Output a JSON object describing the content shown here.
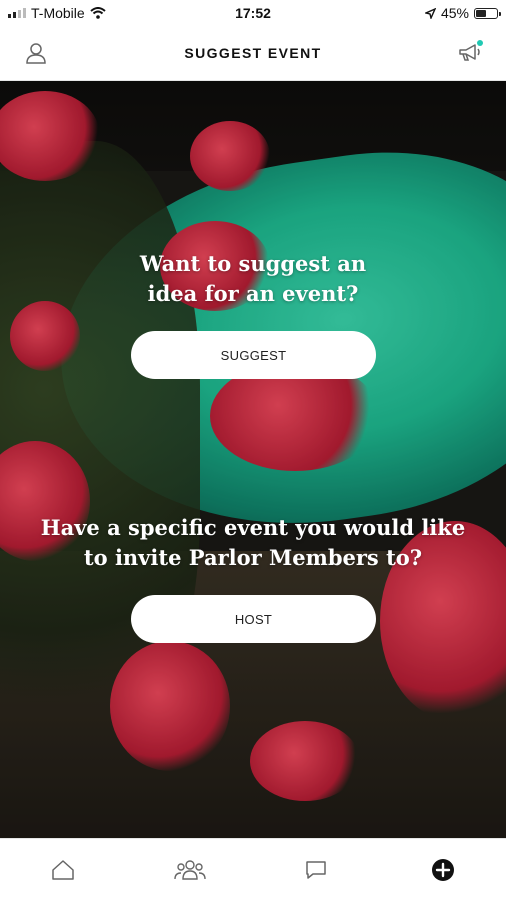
{
  "status_bar": {
    "carrier": "T-Mobile",
    "time": "17:52",
    "battery_percent": "45%",
    "battery_level": 0.45
  },
  "header": {
    "title": "SUGGEST EVENT"
  },
  "hero": {
    "suggest_prompt": "Want to suggest an idea for an event?",
    "suggest_button": "SUGGEST",
    "host_prompt": "Have a specific event you would like to invite Parlor Members to?",
    "host_button": "HOST"
  },
  "bottom_nav": {
    "items": [
      {
        "icon": "home-icon"
      },
      {
        "icon": "members-icon"
      },
      {
        "icon": "chat-icon"
      },
      {
        "icon": "add-icon",
        "active": true
      }
    ]
  },
  "colors": {
    "accent_dot": "#20c9b3",
    "pill_bg": "#ffffff"
  }
}
